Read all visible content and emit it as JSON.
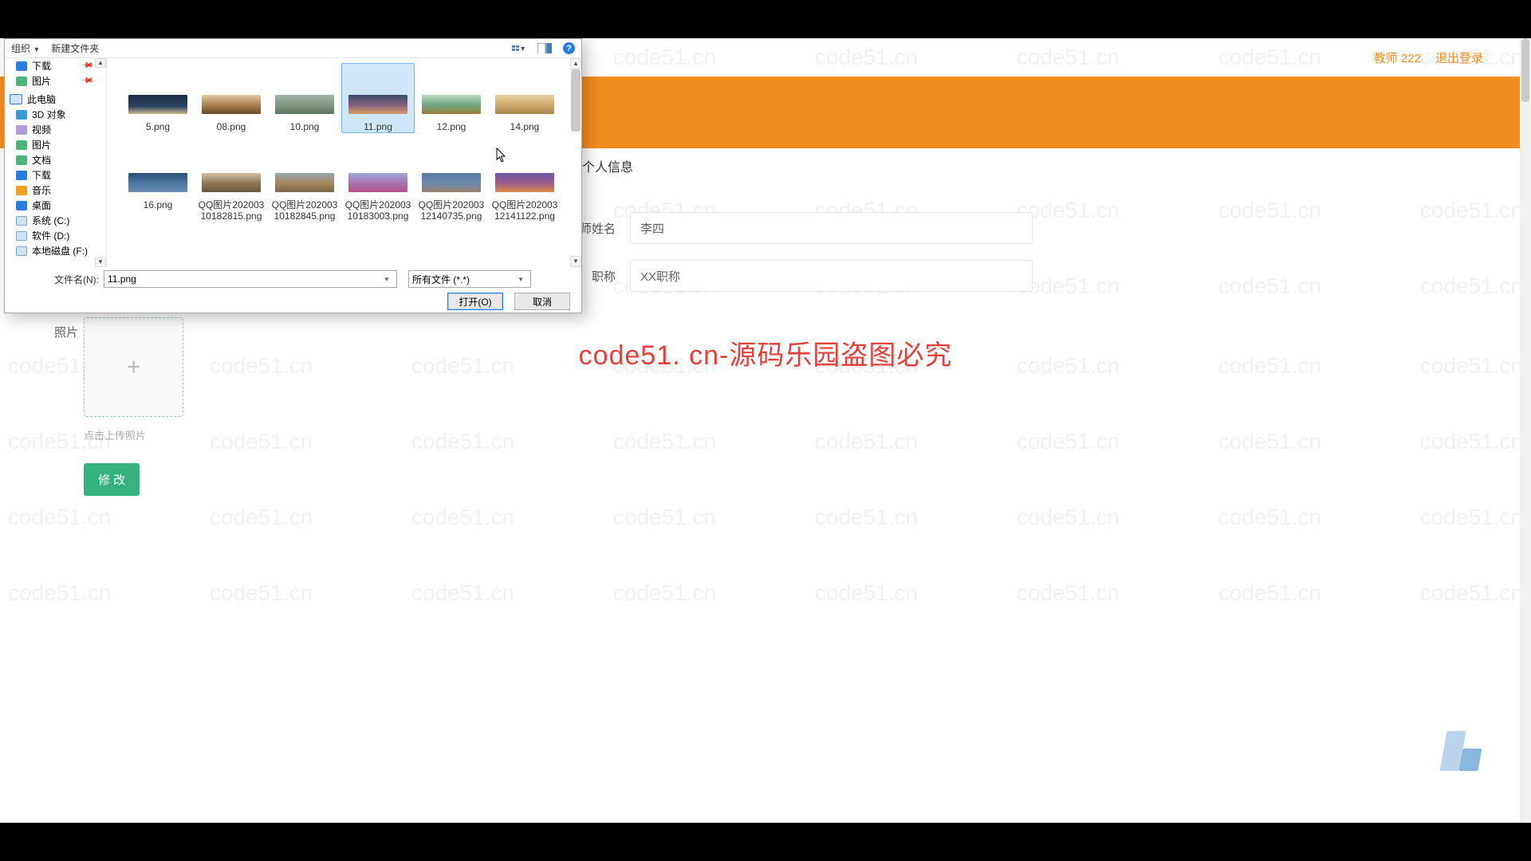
{
  "watermark": {
    "text": "code51.cn",
    "center_text": "code51. cn-源码乐园盗图必究"
  },
  "header": {
    "user": "教师 222",
    "logout": "退出登录"
  },
  "form": {
    "title": "个人信息",
    "name_label": "教师姓名",
    "name_value": "李四",
    "title_label": "职称",
    "title_value": "XX职称",
    "photo_label": "照片",
    "upload_tip": "点击上传照片",
    "submit": "修 改"
  },
  "dialog": {
    "toolbar": {
      "organize": "组织",
      "new_folder": "新建文件夹"
    },
    "nav": {
      "quick": [
        {
          "name": "下载",
          "pin": true
        },
        {
          "name": "图片",
          "pin": true
        }
      ],
      "this_pc": "此电脑",
      "pc_items": [
        "3D 对象",
        "视频",
        "图片",
        "文档",
        "下载",
        "音乐",
        "桌面",
        "系统 (C:)",
        "软件 (D:)",
        "本地磁盘 (F:)"
      ]
    },
    "files": [
      {
        "name": "5.png"
      },
      {
        "name": "08.png"
      },
      {
        "name": "10.png"
      },
      {
        "name": "11.png",
        "selected": true
      },
      {
        "name": "12.png"
      },
      {
        "name": "14.png"
      },
      {
        "name": "16.png"
      },
      {
        "name": "QQ图片20200310182815.png"
      },
      {
        "name": "QQ图片20200310182845.png"
      },
      {
        "name": "QQ图片20200310183003.png"
      },
      {
        "name": "QQ图片20200312140735.png"
      },
      {
        "name": "QQ图片20200312141122.png"
      }
    ],
    "bottom": {
      "filename_label": "文件名(N):",
      "filename_value": "11.png",
      "filetype_value": "所有文件 (*.*)",
      "open": "打开(O)",
      "cancel": "取消"
    }
  }
}
